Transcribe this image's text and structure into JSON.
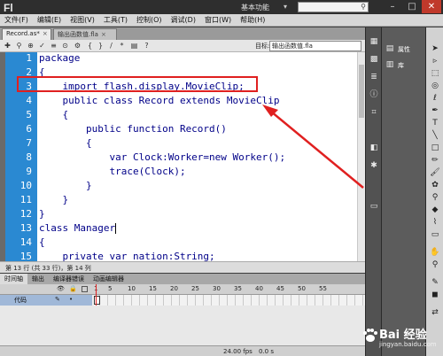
{
  "app": {
    "logo": "Fl",
    "workspace": "基本功能"
  },
  "window_buttons": [
    "–",
    "□",
    "✕"
  ],
  "menu": [
    "文件(F)",
    "编辑(E)",
    "视图(V)",
    "工具(T)",
    "控制(O)",
    "调试(D)",
    "窗口(W)",
    "帮助(H)"
  ],
  "tabs": [
    {
      "label": "Record.as*",
      "active": true
    },
    {
      "label": "输出函数值.fla",
      "active": false
    }
  ],
  "toolbar": {
    "target_label": "目标:",
    "target_value": "输出函数值.fla"
  },
  "editor": {
    "line_numbers": [
      "1",
      "2",
      "3",
      "4",
      "5",
      "6",
      "7",
      "8",
      "9",
      "10",
      "11",
      "12",
      "13",
      "14",
      "15"
    ],
    "lines": [
      "package",
      "{",
      "    import flash.display.MovieClip;",
      "    public class Record extends MovieClip",
      "    {",
      "        public function Record()",
      "        {",
      "            var Clock:Worker=new Worker();",
      "            trace(Clock);",
      "        }",
      "    }",
      "}",
      "class Manager",
      "{",
      "    private var nation:String;"
    ],
    "highlighted_line": 3
  },
  "status": {
    "text": "第 13 行 (共 33 行)，第 14 列"
  },
  "timeline": {
    "tabs": [
      "时间轴",
      "输出",
      "编译器错误",
      "动画编辑器"
    ],
    "frame_numbers": [
      "1",
      "5",
      "10",
      "15",
      "20",
      "25",
      "30",
      "35",
      "40",
      "45",
      "50",
      "55"
    ],
    "layer_name": "代码",
    "fps": "24.00 fps",
    "time": "0.0 s"
  },
  "properties": {
    "label1": "属性",
    "label2": "库"
  },
  "watermark": {
    "text": "Bai 经验",
    "url": "jingyan.baidu.com"
  },
  "colors": {
    "gutter": "#2a89d2",
    "highlight": "#e02020",
    "keyword": "#000088"
  }
}
